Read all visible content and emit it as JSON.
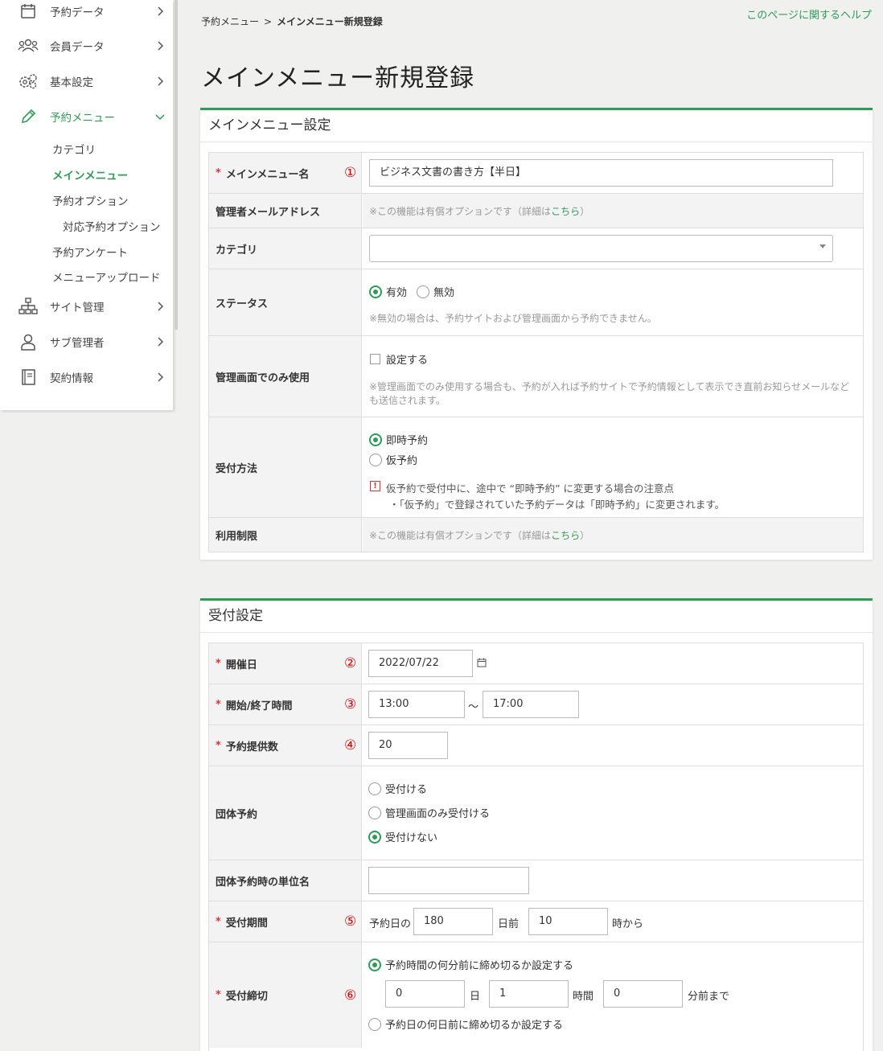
{
  "sidebar": {
    "items": [
      {
        "label": "予約データ",
        "icon": "calendar-icon"
      },
      {
        "label": "会員データ",
        "icon": "users-icon"
      },
      {
        "label": "基本設定",
        "icon": "gears-icon"
      },
      {
        "label": "予約メニュー",
        "icon": "pencil-icon"
      },
      {
        "label": "サイト管理",
        "icon": "sitemap-icon"
      },
      {
        "label": "サブ管理者",
        "icon": "user-icon"
      },
      {
        "label": "契約情報",
        "icon": "book-icon"
      }
    ],
    "submenu": [
      "カテゴリ",
      "メインメニュー",
      "予約オプション",
      "対応予約オプション",
      "予約アンケート",
      "メニューアップロード"
    ],
    "accent_color": "#2e9b57"
  },
  "header": {
    "breadcrumb_parent": "予約メニュー",
    "breadcrumb_sep": ">",
    "breadcrumb_current": "メインメニュー新規登録",
    "help_link": "このページに関するヘルプ",
    "page_title": "メインメニュー新規登録"
  },
  "main_settings": {
    "title": "メインメニュー設定",
    "menu_name": {
      "required": "*",
      "label": "メインメニュー名",
      "num": "①",
      "value": "ビジネス文書の書き方【半日】"
    },
    "admin_email": {
      "label": "管理者メールアドレス",
      "note": "※この機能は有償オプションです（詳細は",
      "link": "こちら",
      "note_end": "）"
    },
    "category": {
      "label": "カテゴリ",
      "value": ""
    },
    "status": {
      "label": "ステータス",
      "opt1": "有効",
      "opt2": "無効",
      "note": "※無効の場合は、予約サイトおよび管理画面から予約できません。"
    },
    "admin_only": {
      "label": "管理画面でのみ使用",
      "check": "設定する",
      "note_line1": "※管理画面でのみ使用する場合も、予約が入れば予約サイトで予約情報として表示でき直前お知らせメールなど",
      "note_line2": "も送信されます。"
    },
    "accept_method": {
      "label": "受付方法",
      "opt1": "即時予約",
      "opt2": "仮予約",
      "warn_icon": "!",
      "warn_line1": "仮予約で受付中に、途中で “即時予約” に変更する場合の注意点",
      "warn_line2": "・「仮予約」で登録されていた予約データは「即時予約」に変更されます。"
    },
    "usage_limit": {
      "label": "利用制限",
      "note": "※この機能は有償オプションです（詳細は",
      "link": "こちら",
      "note_end": "）"
    }
  },
  "reception_settings": {
    "title": "受付設定",
    "date": {
      "required": "*",
      "label": "開催日",
      "num": "②",
      "value": "2022/07/22",
      "icon": "calendar-icon"
    },
    "time": {
      "required": "*",
      "label": "開始/終了時間",
      "num": "③",
      "start": "13:00",
      "tilde": "～",
      "end": "17:00"
    },
    "capacity": {
      "required": "*",
      "label": "予約提供数",
      "num": "④",
      "value": "20"
    },
    "group": {
      "label": "団体予約",
      "opt1": "受付ける",
      "opt2": "管理画面のみ受付ける",
      "opt3": "受付けない"
    },
    "group_unit": {
      "label": "団体予約時の単位名",
      "value": ""
    },
    "period": {
      "required": "*",
      "label": "受付期間",
      "num": "⑤",
      "prefix": "予約日の",
      "days": "180",
      "days_unit": "日前",
      "hours": "10",
      "hours_unit": "時から"
    },
    "deadline": {
      "required": "*",
      "label": "受付締切",
      "num": "⑥",
      "opt1": "予約時間の何分前に締め切るか設定する",
      "d": "0",
      "d_unit": "日",
      "h": "1",
      "h_unit": "時間",
      "m": "0",
      "m_unit": "分前まで",
      "opt2": "予約日の何日前に締め切るか設定する"
    }
  }
}
